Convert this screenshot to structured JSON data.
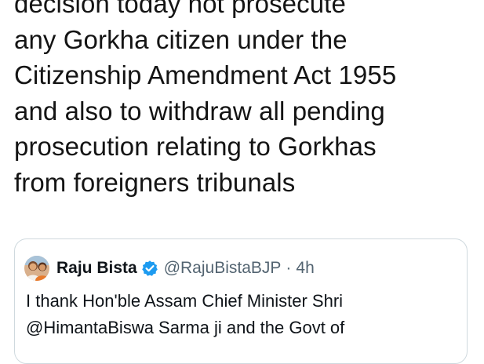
{
  "tweet": {
    "lines": [
      "decision today  not prosecute",
      "any Gorkha citizen under the",
      "Citizenship Amendment  Act 1955",
      "and also to withdraw all pending",
      "prosecution relating to Gorkhas",
      "from foreigners tribunals"
    ]
  },
  "quoted_tweet": {
    "author_name": "Raju Bista",
    "handle": "@RajuBistaBJP",
    "separator": "·",
    "time": "4h",
    "avatar_icon": "profile-photo",
    "verified_icon": "verified-badge",
    "verified_color": "#1d9bf0",
    "lines": [
      "I thank Hon'ble Assam Chief Minister Shri",
      "@HimantaBiswa Sarma ji and the Govt of"
    ]
  },
  "colors": {
    "text": "#0f1419",
    "secondary_text": "#536471",
    "border": "#cfd9de",
    "background": "#ffffff"
  }
}
